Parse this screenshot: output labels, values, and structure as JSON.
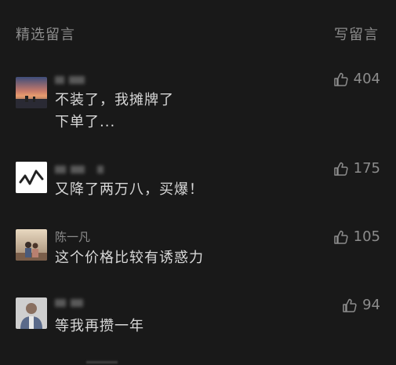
{
  "header": {
    "title": "精选留言",
    "write_label": "写留言"
  },
  "comments": [
    {
      "name": "",
      "text_line1": "不装了，我摊牌了",
      "text_line2": "下单了...",
      "likes": "404",
      "avatar": "sunset-photo"
    },
    {
      "name": "",
      "text_line1": "又降了两万八，买爆！",
      "likes": "175",
      "avatar": "pulse-logo"
    },
    {
      "name": "陈一凡",
      "text_line1": "这个价格比较有诱惑力",
      "likes": "105",
      "avatar": "couple-photo"
    },
    {
      "name": "",
      "text_line1": "等我再攒一年",
      "likes": "94",
      "avatar": "person-photo"
    }
  ],
  "colors": {
    "background": "#191919",
    "text": "#d8d8d8",
    "muted": "#8c8c8c"
  }
}
